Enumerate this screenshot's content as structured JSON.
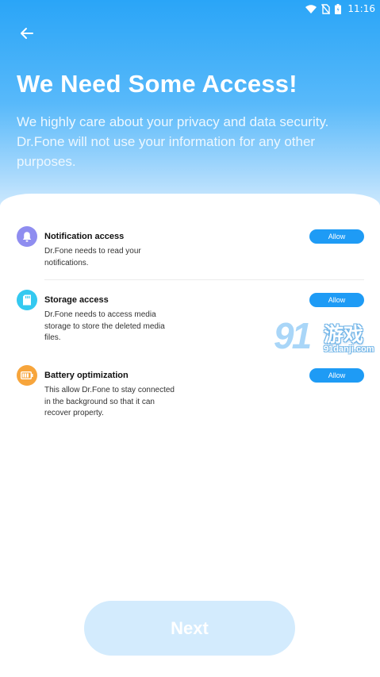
{
  "status_bar": {
    "time": "11:16",
    "icons": [
      "wifi-icon",
      "no-sim-icon",
      "battery-icon"
    ]
  },
  "header": {
    "back_icon": "arrow-left-icon",
    "title": "We Need Some Access!",
    "subtitle": "We highly care about your privacy and data security. Dr.Fone will not use your information for any other purposes."
  },
  "permissions": [
    {
      "icon": "bell-icon",
      "icon_color": "#8f8df0",
      "title": "Notification access",
      "description": "Dr.Fone needs to read your notifications.",
      "button_label": "Allow"
    },
    {
      "icon": "sd-card-icon",
      "icon_color": "#34c9f0",
      "title": "Storage access",
      "description": "Dr.Fone needs to access media storage to store the deleted media files.",
      "button_label": "Allow"
    },
    {
      "icon": "battery-icon",
      "icon_color": "#f7a53c",
      "title": "Battery optimization",
      "description": "This allow Dr.Fone to stay connected in the background so that it can recover property.",
      "button_label": "Allow"
    }
  ],
  "watermark": {
    "logo": "91",
    "text": "游戏",
    "url": "91danji.com"
  },
  "footer": {
    "next_label": "Next"
  },
  "colors": {
    "accent": "#1e9bf5",
    "hero_top": "#2aa5f7",
    "next_disabled": "#d3ebfd"
  }
}
